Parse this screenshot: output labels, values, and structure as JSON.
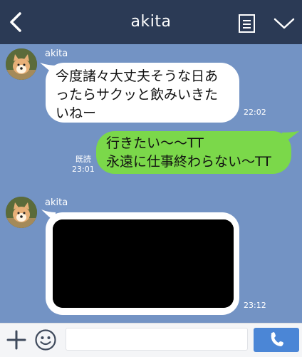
{
  "header": {
    "title": "akita",
    "back_icon": "chevron-left-icon",
    "notes_icon": "note-list-icon",
    "menu_icon": "chevron-down-icon"
  },
  "messages": [
    {
      "direction": "in",
      "sender": "akita",
      "lines": [
        "今度諸々大丈夫そうな日あ",
        "ったらサクッと飲みいきた",
        "いねー"
      ],
      "time": "22:02"
    },
    {
      "direction": "out",
      "read_label": "既読",
      "lines": [
        "行きたい〜〜TT",
        "永遠に仕事終わらない〜TT"
      ],
      "time": "23:01"
    },
    {
      "direction": "in",
      "sender": "akita",
      "content": "redacted-image",
      "time": "23:12"
    }
  ],
  "input": {
    "plus_icon": "plus-icon",
    "emoji_icon": "smiley-icon",
    "value": "",
    "send_icon": "phone-icon"
  },
  "colors": {
    "header": "#2b3a55",
    "background": "#7393c4",
    "incoming_bubble": "#ffffff",
    "outgoing_bubble": "#7bd84a",
    "send_button": "#4b86d6"
  }
}
